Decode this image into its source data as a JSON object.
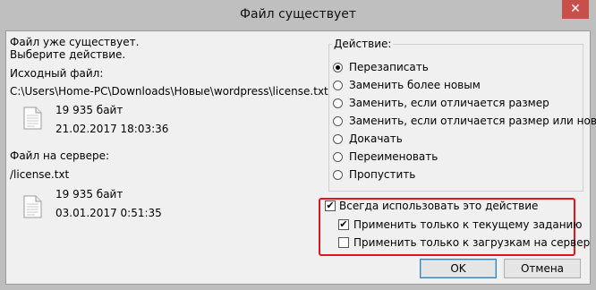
{
  "window": {
    "title": "Файл существует",
    "close_glyph": "✕"
  },
  "message": {
    "line1": "Файл уже существует.",
    "line2": "Выберите действие."
  },
  "source": {
    "heading": "Исходный файл:",
    "path": "C:\\Users\\Home-PC\\Downloads\\Новые\\wordpress\\license.txt",
    "size": "19 935 байт",
    "date": "21.02.2017 18:03:36"
  },
  "server": {
    "heading": "Файл на сервере:",
    "path": "/license.txt",
    "size": "19 935 байт",
    "date": "03.01.2017 0:51:35"
  },
  "action": {
    "label": "Действие:",
    "options": [
      {
        "label": "Перезаписать",
        "selected": true
      },
      {
        "label": "Заменить более новым",
        "selected": false
      },
      {
        "label": "Заменить, если отличается размер",
        "selected": false
      },
      {
        "label": "Заменить, если отличается размер или новее",
        "selected": false
      },
      {
        "label": "Докачать",
        "selected": false
      },
      {
        "label": "Переименовать",
        "selected": false
      },
      {
        "label": "Пропустить",
        "selected": false
      }
    ]
  },
  "checkboxes": {
    "always": {
      "label": "Всегда использовать это действие",
      "checked": true
    },
    "current_task": {
      "label": "Применить только к текущему заданию",
      "checked": true
    },
    "uploads_only": {
      "label": "Применить только к загрузкам на сервер",
      "checked": false
    },
    "check_glyph": "✔"
  },
  "buttons": {
    "ok": "OK",
    "cancel": "Отмена"
  },
  "colors": {
    "highlight_border": "#e0161c",
    "close_button": "#c7504b"
  },
  "icons": {
    "file": "document-file-icon"
  }
}
